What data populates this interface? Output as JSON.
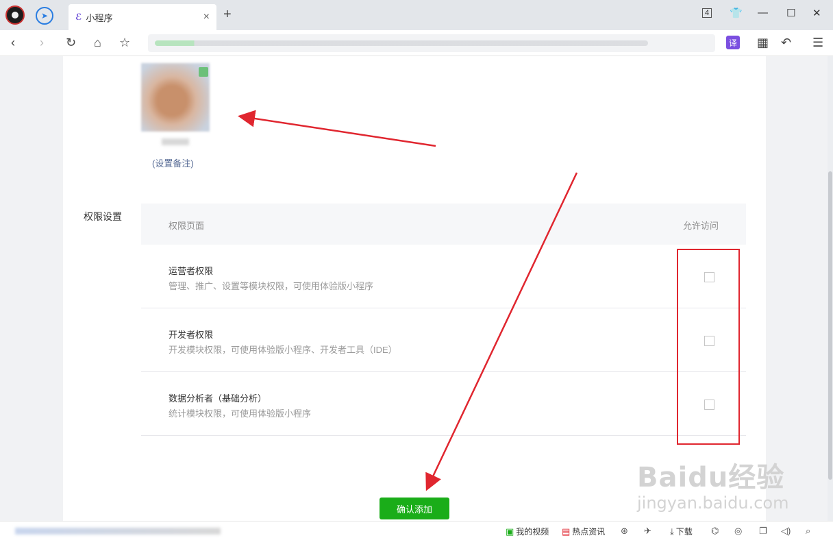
{
  "browser": {
    "tab_title": "小程序",
    "tab_icon": "mini-program-icon",
    "tab_count": "4"
  },
  "page": {
    "remark_link": "(设置备注)",
    "permission_label": "权限设置",
    "table": {
      "col_page": "权限页面",
      "col_allow": "允许访问",
      "rows": [
        {
          "title": "运营者权限",
          "desc": "管理、推广、设置等模块权限，可使用体验版小程序",
          "checked": false
        },
        {
          "title": "开发者权限",
          "desc": "开发模块权限，可使用体验版小程序、开发者工具（IDE）",
          "checked": false
        },
        {
          "title": "数据分析者（基础分析）",
          "desc": "统计模块权限，可使用体验版小程序",
          "checked": false
        }
      ]
    },
    "confirm_button": "确认添加"
  },
  "watermark": {
    "brand": "Baidu经验",
    "url": "jingyan.baidu.com"
  },
  "statusbar": {
    "my_video": "我的视频",
    "hot_news": "热点资讯",
    "download": "下载"
  },
  "colors": {
    "accent_green": "#1aad19",
    "annotation_red": "#e0262f",
    "link_blue": "#576b95"
  }
}
